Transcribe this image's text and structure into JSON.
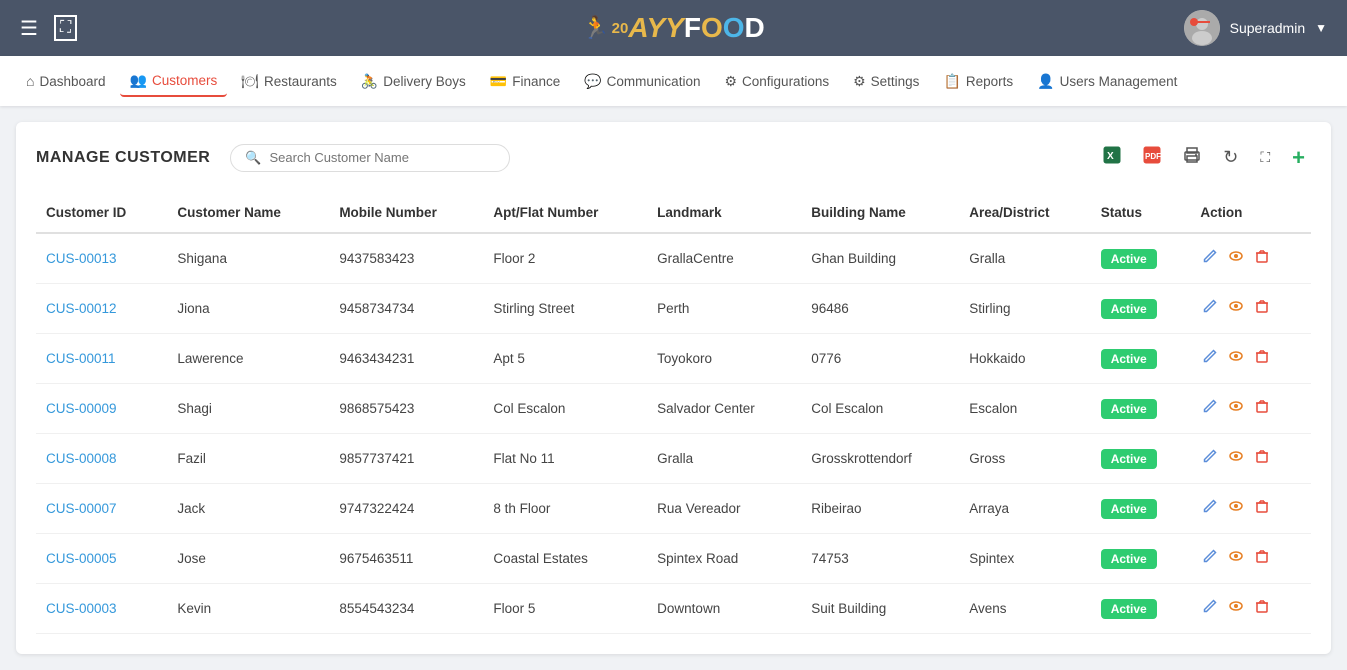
{
  "header": {
    "title": "AYY FOOD",
    "user": "Superadmin",
    "hamburger": "☰",
    "expand": "⛶"
  },
  "nav": {
    "items": [
      {
        "id": "dashboard",
        "label": "Dashboard",
        "icon": "⌂",
        "active": false
      },
      {
        "id": "customers",
        "label": "Customers",
        "icon": "👥",
        "active": true
      },
      {
        "id": "restaurants",
        "label": "Restaurants",
        "icon": "🍽",
        "active": false
      },
      {
        "id": "delivery-boys",
        "label": "Delivery Boys",
        "icon": "🚴",
        "active": false
      },
      {
        "id": "finance",
        "label": "Finance",
        "icon": "💳",
        "active": false
      },
      {
        "id": "communication",
        "label": "Communication",
        "icon": "💬",
        "active": false
      },
      {
        "id": "configurations",
        "label": "Configurations",
        "icon": "⚙",
        "active": false
      },
      {
        "id": "settings",
        "label": "Settings",
        "icon": "⚙",
        "active": false
      },
      {
        "id": "reports",
        "label": "Reports",
        "icon": "📋",
        "active": false
      },
      {
        "id": "users-management",
        "label": "Users Management",
        "icon": "👤",
        "active": false
      }
    ]
  },
  "page": {
    "title": "MANAGE CUSTOMER",
    "search_placeholder": "Search Customer Name"
  },
  "toolbar": {
    "excel_icon": "📊",
    "pdf_icon": "📄",
    "print_icon": "🖨",
    "refresh_icon": "↻",
    "fullscreen_icon": "⛶",
    "add_icon": "+"
  },
  "table": {
    "columns": [
      "Customer ID",
      "Customer Name",
      "Mobile Number",
      "Apt/Flat Number",
      "Landmark",
      "Building Name",
      "Area/District",
      "Status",
      "Action"
    ],
    "rows": [
      {
        "id": "CUS-00013",
        "name": "Shigana",
        "mobile": "9437583423",
        "apt": "Floor 2",
        "landmark": "GrallaCentre",
        "building": "Ghan Building",
        "area": "Gralla",
        "status": "Active"
      },
      {
        "id": "CUS-00012",
        "name": "Jiona",
        "mobile": "9458734734",
        "apt": "Stirling Street",
        "landmark": "Perth",
        "building": "96486",
        "area": "Stirling",
        "status": "Active"
      },
      {
        "id": "CUS-00011",
        "name": "Lawerence",
        "mobile": "9463434231",
        "apt": "Apt 5",
        "landmark": "Toyokoro",
        "building": "0776",
        "area": "Hokkaido",
        "status": "Active"
      },
      {
        "id": "CUS-00009",
        "name": "Shagi",
        "mobile": "9868575423",
        "apt": "Col Escalon",
        "landmark": "Salvador Center",
        "building": "Col Escalon",
        "area": "Escalon",
        "status": "Active"
      },
      {
        "id": "CUS-00008",
        "name": "Fazil",
        "mobile": "9857737421",
        "apt": "Flat No 11",
        "landmark": "Gralla",
        "building": "Grosskrottendorf",
        "area": "Gross",
        "status": "Active"
      },
      {
        "id": "CUS-00007",
        "name": "Jack",
        "mobile": "9747322424",
        "apt": "8 th Floor",
        "landmark": "Rua Vereador",
        "building": "Ribeirao",
        "area": "Arraya",
        "status": "Active"
      },
      {
        "id": "CUS-00005",
        "name": "Jose",
        "mobile": "9675463511",
        "apt": "Coastal Estates",
        "landmark": "Spintex Road",
        "building": "74753",
        "area": "Spintex",
        "status": "Active"
      },
      {
        "id": "CUS-00003",
        "name": "Kevin",
        "mobile": "8554543234",
        "apt": "Floor 5",
        "landmark": "Downtown",
        "building": "Suit Building",
        "area": "Avens",
        "status": "Active"
      }
    ]
  },
  "status": {
    "active_color": "#2ecc71",
    "active_label": "Active"
  }
}
